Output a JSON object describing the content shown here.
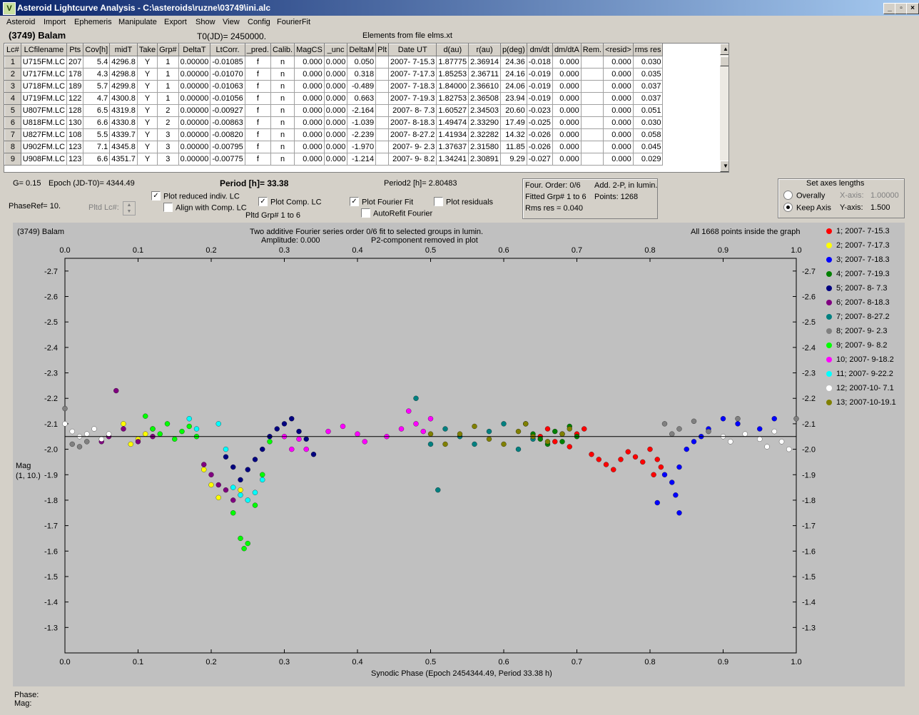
{
  "window": {
    "title": "Asteroid Lightcurve Analysis - C:\\asteroids\\ruzne\\03749\\ini.alc",
    "icon_label": "V"
  },
  "menu": [
    "Asteroid",
    "Import",
    "Ephemeris",
    "Manipulate",
    "Export",
    "Show",
    "View",
    "Config",
    "FourierFit"
  ],
  "header": {
    "asteroid_name": "(3749) Balam",
    "t0": "T0(JD)= 2450000.",
    "elements": "Elements from file elms.xt"
  },
  "table": {
    "columns": [
      "Lc#",
      "LCfilename",
      "Pts",
      "Cov[h]",
      "midT",
      "Take",
      "Grp#",
      "DeltaT",
      "LtCorr.",
      "_pred.",
      "Calib.",
      "MagCS",
      "_unc",
      "DeltaM",
      "Plt",
      "Date UT",
      "d(au)",
      "r(au)",
      "p(deg)",
      "dm/dt",
      "dm/dtA",
      "Rem.",
      "<resid>",
      "rms res"
    ],
    "rows": [
      [
        "1",
        "U715FM.LC",
        "207",
        "5.4",
        "4296.8",
        "Y",
        "1",
        "0.00000",
        "-0.01085",
        "f",
        "n",
        "0.000",
        "0.000",
        "0.050",
        "",
        "2007- 7-15.3",
        "1.87775",
        "2.36914",
        "24.36",
        "-0.018",
        "0.000",
        "",
        "0.000",
        "0.030"
      ],
      [
        "2",
        "U717FM.LC",
        "178",
        "4.3",
        "4298.8",
        "Y",
        "1",
        "0.00000",
        "-0.01070",
        "f",
        "n",
        "0.000",
        "0.000",
        "0.318",
        "",
        "2007- 7-17.3",
        "1.85253",
        "2.36711",
        "24.16",
        "-0.019",
        "0.000",
        "",
        "0.000",
        "0.035"
      ],
      [
        "3",
        "U718FM.LC",
        "189",
        "5.7",
        "4299.8",
        "Y",
        "1",
        "0.00000",
        "-0.01063",
        "f",
        "n",
        "0.000",
        "0.000",
        "-0.489",
        "",
        "2007- 7-18.3",
        "1.84000",
        "2.36610",
        "24.06",
        "-0.019",
        "0.000",
        "",
        "0.000",
        "0.037"
      ],
      [
        "4",
        "U719FM.LC",
        "122",
        "4.7",
        "4300.8",
        "Y",
        "1",
        "0.00000",
        "-0.01056",
        "f",
        "n",
        "0.000",
        "0.000",
        "0.663",
        "",
        "2007- 7-19.3",
        "1.82753",
        "2.36508",
        "23.94",
        "-0.019",
        "0.000",
        "",
        "0.000",
        "0.037"
      ],
      [
        "5",
        "U807FM.LC",
        "128",
        "6.5",
        "4319.8",
        "Y",
        "2",
        "0.00000",
        "-0.00927",
        "f",
        "n",
        "0.000",
        "0.000",
        "-2.164",
        "",
        "2007- 8- 7.3",
        "1.60527",
        "2.34503",
        "20.60",
        "-0.023",
        "0.000",
        "",
        "0.000",
        "0.051"
      ],
      [
        "6",
        "U818FM.LC",
        "130",
        "6.6",
        "4330.8",
        "Y",
        "2",
        "0.00000",
        "-0.00863",
        "f",
        "n",
        "0.000",
        "0.000",
        "-1.039",
        "",
        "2007- 8-18.3",
        "1.49474",
        "2.33290",
        "17.49",
        "-0.025",
        "0.000",
        "",
        "0.000",
        "0.030"
      ],
      [
        "7",
        "U827FM.LC",
        "108",
        "5.5",
        "4339.7",
        "Y",
        "3",
        "0.00000",
        "-0.00820",
        "f",
        "n",
        "0.000",
        "0.000",
        "-2.239",
        "",
        "2007- 8-27.2",
        "1.41934",
        "2.32282",
        "14.32",
        "-0.026",
        "0.000",
        "",
        "0.000",
        "0.058"
      ],
      [
        "8",
        "U902FM.LC",
        "123",
        "7.1",
        "4345.8",
        "Y",
        "3",
        "0.00000",
        "-0.00795",
        "f",
        "n",
        "0.000",
        "0.000",
        "-1.970",
        "",
        "2007- 9- 2.3",
        "1.37637",
        "2.31580",
        "11.85",
        "-0.026",
        "0.000",
        "",
        "0.000",
        "0.045"
      ],
      [
        "9",
        "U908FM.LC",
        "123",
        "6.6",
        "4351.7",
        "Y",
        "3",
        "0.00000",
        "-0.00775",
        "f",
        "n",
        "0.000",
        "0.000",
        "-1.214",
        "",
        "2007- 9- 8.2",
        "1.34241",
        "2.30891",
        "9.29",
        "-0.027",
        "0.000",
        "",
        "0.000",
        "0.029"
      ]
    ]
  },
  "params": {
    "g": "G= 0.15",
    "epoch": "Epoch (JD-T0)= 4344.49",
    "period": "Period [h]= 33.38",
    "period2": "Period2 [h]= 2.80483",
    "phaseref": "PhaseRef= 10.",
    "pltd_lc": "Pltd Lc#:",
    "pltd_grp": "Pltd Grp#  1   to   6"
  },
  "checkboxes": {
    "reduced": {
      "label": "Plot reduced indiv. LC",
      "checked": true
    },
    "align": {
      "label": "Align with Comp. LC",
      "checked": false
    },
    "comp": {
      "label": "Plot Comp. LC",
      "checked": true
    },
    "fourier": {
      "label": "Plot Fourier Fit",
      "checked": true
    },
    "residuals": {
      "label": "Plot residuals",
      "checked": false
    },
    "autorefit": {
      "label": "AutoRefit Fourier",
      "checked": false
    }
  },
  "fourier_info": {
    "order": "Four. Order:  0/6",
    "add": "Add. 2-P, in lumin.",
    "fitted": "Fitted Grp# 1 to 6",
    "points": "Points: 1268",
    "rms": "Rms res     = 0.040"
  },
  "axes_box": {
    "title": "Set axes lengths",
    "overally": "Overally",
    "keep": "Keep Axis",
    "xaxis_label": "X-axis:",
    "xaxis_value": "1.00000",
    "yaxis_label": "Y-axis:",
    "yaxis_value": "1.500"
  },
  "plot": {
    "name": "(3749) Balam",
    "title1": "Two additive Fourier series order 0/6 fit to selected groups in lumin.",
    "title2": "Amplitude: 0.000",
    "title3": "P2-component removed in plot",
    "points_note": "All 1668 points inside the graph",
    "ylabel1": "Mag",
    "ylabel2": "(1, 10.)",
    "xlabel": "Synodic Phase (Epoch 2454344.49, Period 33.38 h)"
  },
  "chart_data": {
    "type": "scatter",
    "xlim": [
      0,
      1
    ],
    "ylim": [
      -1.2,
      -2.75
    ],
    "y_inverted": true,
    "x_ticks": [
      "0.0",
      "0.1",
      "0.2",
      "0.3",
      "0.4",
      "0.5",
      "0.6",
      "0.7",
      "0.8",
      "0.9",
      "1.0"
    ],
    "y_ticks": [
      "-2.7",
      "-2.6",
      "-2.5",
      "-2.4",
      "-2.3",
      "-2.2",
      "-2.1",
      "-2.0",
      "-1.9",
      "-1.8",
      "-1.7",
      "-1.6",
      "-1.5",
      "-1.4",
      "-1.3"
    ],
    "fit_line_y": -2.05,
    "series": [
      {
        "name": "1; 2007- 7-15.3",
        "color": "#ff0000",
        "points": [
          [
            0.65,
            -2.05
          ],
          [
            0.66,
            -2.08
          ],
          [
            0.67,
            -2.03
          ],
          [
            0.68,
            -2.06
          ],
          [
            0.69,
            -2.01
          ],
          [
            0.7,
            -2.06
          ],
          [
            0.71,
            -2.08
          ],
          [
            0.72,
            -1.98
          ],
          [
            0.73,
            -1.96
          ],
          [
            0.74,
            -1.94
          ],
          [
            0.75,
            -1.92
          ],
          [
            0.76,
            -1.96
          ],
          [
            0.77,
            -1.99
          ],
          [
            0.78,
            -1.97
          ],
          [
            0.79,
            -1.95
          ],
          [
            0.8,
            -2.0
          ],
          [
            0.81,
            -1.96
          ],
          [
            0.805,
            -1.9
          ],
          [
            0.815,
            -1.93
          ]
        ]
      },
      {
        "name": "2; 2007- 7-17.3",
        "color": "#ffff00",
        "points": [
          [
            0.08,
            -2.1
          ],
          [
            0.09,
            -2.02
          ],
          [
            0.1,
            -2.04
          ],
          [
            0.11,
            -2.06
          ],
          [
            0.12,
            -2.08
          ],
          [
            0.19,
            -1.92
          ],
          [
            0.2,
            -1.86
          ],
          [
            0.21,
            -1.81
          ],
          [
            0.24,
            -1.84
          ]
        ]
      },
      {
        "name": "3; 2007- 7-18.3",
        "color": "#0000ff",
        "points": [
          [
            0.81,
            -1.79
          ],
          [
            0.82,
            -1.9
          ],
          [
            0.83,
            -1.87
          ],
          [
            0.84,
            -1.93
          ],
          [
            0.85,
            -2.0
          ],
          [
            0.86,
            -2.03
          ],
          [
            0.87,
            -2.05
          ],
          [
            0.88,
            -2.08
          ],
          [
            0.9,
            -2.12
          ],
          [
            0.92,
            -2.1
          ],
          [
            0.95,
            -2.08
          ],
          [
            0.97,
            -2.12
          ],
          [
            0.84,
            -1.75
          ],
          [
            0.835,
            -1.82
          ]
        ]
      },
      {
        "name": "4; 2007- 7-19.3",
        "color": "#008000",
        "points": [
          [
            0.63,
            -2.1
          ],
          [
            0.64,
            -2.06
          ],
          [
            0.65,
            -2.04
          ],
          [
            0.66,
            -2.02
          ],
          [
            0.67,
            -2.07
          ],
          [
            0.68,
            -2.03
          ],
          [
            0.69,
            -2.09
          ],
          [
            0.7,
            -2.05
          ]
        ]
      },
      {
        "name": "5; 2007- 8- 7.3",
        "color": "#000080",
        "points": [
          [
            0.22,
            -1.97
          ],
          [
            0.23,
            -1.93
          ],
          [
            0.24,
            -1.88
          ],
          [
            0.25,
            -1.92
          ],
          [
            0.26,
            -1.96
          ],
          [
            0.27,
            -2.0
          ],
          [
            0.28,
            -2.05
          ],
          [
            0.29,
            -2.08
          ],
          [
            0.3,
            -2.1
          ],
          [
            0.31,
            -2.12
          ],
          [
            0.32,
            -2.07
          ],
          [
            0.33,
            -2.04
          ],
          [
            0.34,
            -1.98
          ]
        ]
      },
      {
        "name": "6; 2007- 8-18.3",
        "color": "#800080",
        "points": [
          [
            0.05,
            -2.03
          ],
          [
            0.06,
            -2.05
          ],
          [
            0.07,
            -2.23
          ],
          [
            0.08,
            -2.08
          ],
          [
            0.1,
            -2.03
          ],
          [
            0.12,
            -2.05
          ],
          [
            0.19,
            -1.94
          ],
          [
            0.2,
            -1.9
          ],
          [
            0.21,
            -1.86
          ],
          [
            0.22,
            -1.84
          ],
          [
            0.23,
            -1.8
          ]
        ]
      },
      {
        "name": "7; 2007- 8-27.2",
        "color": "#008080",
        "points": [
          [
            0.48,
            -2.2
          ],
          [
            0.5,
            -2.02
          ],
          [
            0.51,
            -1.84
          ],
          [
            0.52,
            -2.08
          ],
          [
            0.54,
            -2.05
          ],
          [
            0.56,
            -2.02
          ],
          [
            0.58,
            -2.07
          ],
          [
            0.6,
            -2.1
          ],
          [
            0.62,
            -2.0
          ],
          [
            0.64,
            -2.04
          ]
        ]
      },
      {
        "name": "8; 2007- 9- 2.3",
        "color": "#808080",
        "points": [
          [
            0.0,
            -2.16
          ],
          [
            0.01,
            -2.02
          ],
          [
            0.02,
            -2.01
          ],
          [
            0.03,
            -2.03
          ],
          [
            0.82,
            -2.1
          ],
          [
            0.83,
            -2.06
          ],
          [
            0.84,
            -2.08
          ],
          [
            0.86,
            -2.11
          ],
          [
            0.88,
            -2.07
          ],
          [
            0.92,
            -2.12
          ],
          [
            1.0,
            -2.12
          ]
        ]
      },
      {
        "name": "9; 2007- 9- 8.2",
        "color": "#00ff00",
        "points": [
          [
            0.11,
            -2.13
          ],
          [
            0.12,
            -2.08
          ],
          [
            0.13,
            -2.06
          ],
          [
            0.14,
            -2.1
          ],
          [
            0.15,
            -2.04
          ],
          [
            0.16,
            -2.07
          ],
          [
            0.17,
            -2.09
          ],
          [
            0.18,
            -2.05
          ],
          [
            0.23,
            -1.75
          ],
          [
            0.24,
            -1.65
          ],
          [
            0.245,
            -1.61
          ],
          [
            0.25,
            -1.63
          ],
          [
            0.26,
            -1.78
          ],
          [
            0.27,
            -1.9
          ],
          [
            0.28,
            -2.03
          ]
        ]
      },
      {
        "name": "10; 2007- 9-18.2",
        "color": "#ff00ff",
        "points": [
          [
            0.3,
            -2.05
          ],
          [
            0.31,
            -2.0
          ],
          [
            0.32,
            -2.04
          ],
          [
            0.33,
            -2.0
          ],
          [
            0.36,
            -2.07
          ],
          [
            0.38,
            -2.09
          ],
          [
            0.4,
            -2.06
          ],
          [
            0.41,
            -2.03
          ],
          [
            0.44,
            -2.05
          ],
          [
            0.46,
            -2.08
          ],
          [
            0.47,
            -2.15
          ],
          [
            0.48,
            -2.1
          ],
          [
            0.49,
            -2.07
          ],
          [
            0.5,
            -2.12
          ]
        ]
      },
      {
        "name": "11; 2007- 9-22.2",
        "color": "#00ffff",
        "points": [
          [
            0.17,
            -2.12
          ],
          [
            0.18,
            -2.08
          ],
          [
            0.21,
            -2.1
          ],
          [
            0.22,
            -2.0
          ],
          [
            0.23,
            -1.85
          ],
          [
            0.24,
            -1.82
          ],
          [
            0.25,
            -1.8
          ],
          [
            0.26,
            -1.83
          ],
          [
            0.27,
            -1.88
          ]
        ]
      },
      {
        "name": "12; 2007-10- 7.1",
        "color": "#ffffff",
        "points": [
          [
            0.0,
            -2.1
          ],
          [
            0.01,
            -2.07
          ],
          [
            0.02,
            -2.05
          ],
          [
            0.03,
            -2.06
          ],
          [
            0.04,
            -2.08
          ],
          [
            0.05,
            -2.04
          ],
          [
            0.06,
            -2.06
          ],
          [
            0.9,
            -2.05
          ],
          [
            0.91,
            -2.03
          ],
          [
            0.93,
            -2.06
          ],
          [
            0.95,
            -2.04
          ],
          [
            0.96,
            -2.01
          ],
          [
            0.97,
            -2.07
          ],
          [
            0.98,
            -2.03
          ],
          [
            0.99,
            -2.0
          ]
        ]
      },
      {
        "name": "13; 2007-10-19.1",
        "color": "#808000",
        "points": [
          [
            0.5,
            -2.06
          ],
          [
            0.52,
            -2.02
          ],
          [
            0.54,
            -2.06
          ],
          [
            0.56,
            -2.09
          ],
          [
            0.58,
            -2.04
          ],
          [
            0.6,
            -2.02
          ],
          [
            0.62,
            -2.07
          ],
          [
            0.63,
            -2.1
          ],
          [
            0.64,
            -2.05
          ],
          [
            0.66,
            -2.03
          ],
          [
            0.68,
            -2.06
          ],
          [
            0.69,
            -2.08
          ]
        ]
      }
    ]
  },
  "status": {
    "phase": "Phase:",
    "mag": "Mag:"
  }
}
